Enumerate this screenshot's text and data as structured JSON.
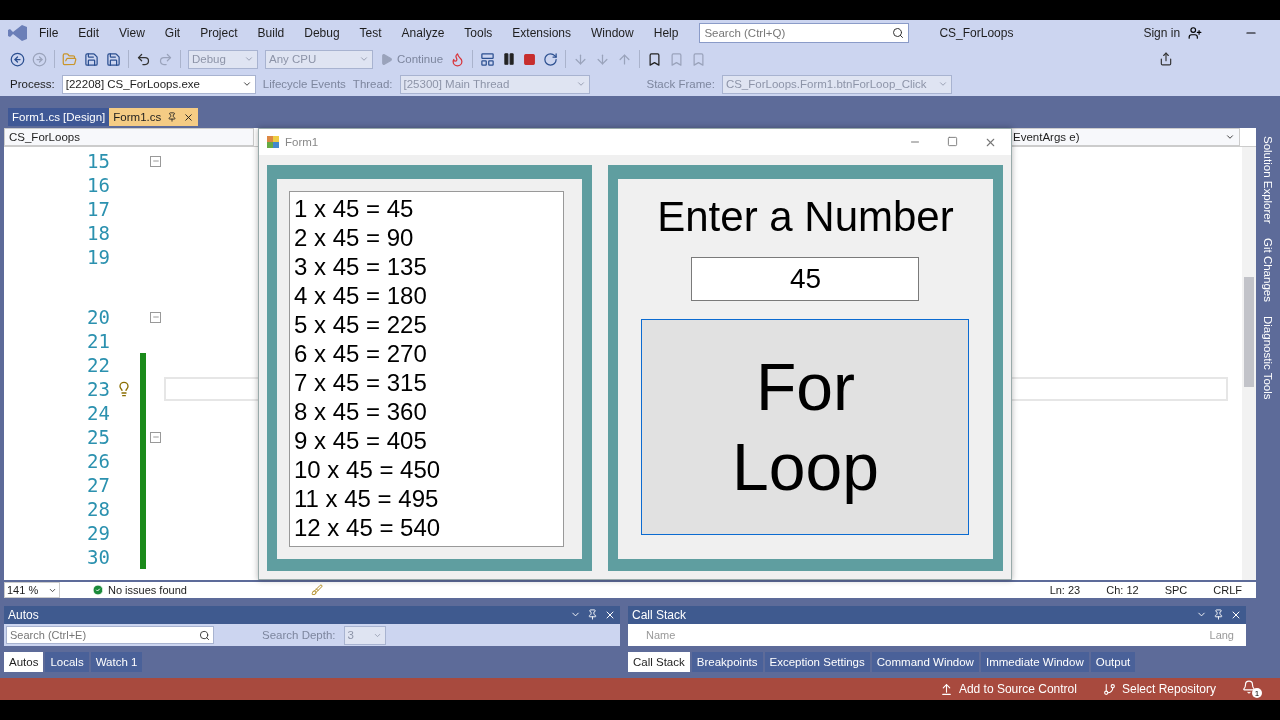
{
  "menu": [
    "File",
    "Edit",
    "View",
    "Git",
    "Project",
    "Build",
    "Debug",
    "Test",
    "Analyze",
    "Tools",
    "Extensions",
    "Window",
    "Help"
  ],
  "search": {
    "placeholder": "Search (Ctrl+Q)"
  },
  "solution_title": "CS_ForLoops",
  "sign_in": "Sign in",
  "toolbar": {
    "configuration": "Debug",
    "platform": "Any CPU",
    "continue": "Continue"
  },
  "debug_location": {
    "process_label": "Process:",
    "process": "[22208] CS_ForLoops.exe",
    "lifecycle": "Lifecycle Events",
    "thread_label": "Thread:",
    "thread": "[25300] Main Thread",
    "stack_frame_label": "Stack Frame:",
    "stack_frame": "CS_ForLoops.Form1.btnForLoop_Click"
  },
  "document_tabs": [
    {
      "label": "Form1.cs [Design]",
      "selected": false
    },
    {
      "label": "Form1.cs",
      "selected": true
    }
  ],
  "navigation": {
    "project": "CS_ForLoops",
    "member": "EventArgs e)"
  },
  "lines": [
    {
      "kind": "line",
      "number": "15",
      "fold": true,
      "changed": false,
      "current": false
    },
    {
      "kind": "line",
      "number": "16",
      "fold": false,
      "changed": false,
      "current": false
    },
    {
      "kind": "line",
      "number": "17",
      "fold": false,
      "changed": false,
      "current": false
    },
    {
      "kind": "line",
      "number": "18",
      "fold": false,
      "changed": false,
      "current": false
    },
    {
      "kind": "line",
      "number": "19",
      "fold": false,
      "changed": false,
      "current": false
    },
    {
      "kind": "codelens"
    },
    {
      "kind": "line",
      "number": "20",
      "fold": true,
      "changed": false,
      "current": false
    },
    {
      "kind": "line",
      "number": "21",
      "fold": false,
      "changed": false,
      "current": false
    },
    {
      "kind": "line",
      "number": "22",
      "fold": false,
      "changed": true,
      "current": false
    },
    {
      "kind": "line",
      "number": "23",
      "fold": false,
      "changed": true,
      "current": true
    },
    {
      "kind": "line",
      "number": "24",
      "fold": false,
      "changed": true,
      "current": false
    },
    {
      "kind": "line",
      "number": "25",
      "fold": true,
      "changed": true,
      "current": false
    },
    {
      "kind": "line",
      "number": "26",
      "fold": false,
      "changed": true,
      "current": false
    },
    {
      "kind": "line",
      "number": "27",
      "fold": false,
      "changed": true,
      "current": false
    },
    {
      "kind": "line",
      "number": "28",
      "fold": false,
      "changed": true,
      "current": false
    },
    {
      "kind": "line",
      "number": "29",
      "fold": false,
      "changed": true,
      "current": false
    },
    {
      "kind": "line",
      "number": "30",
      "fold": false,
      "changed": true,
      "current": false
    }
  ],
  "form": {
    "title": "Form1",
    "results": [
      "1 x 45 = 45",
      "2 x 45 = 90",
      "3 x 45 = 135",
      "4 x 45 = 180",
      "5 x 45 = 225",
      "6 x 45 = 270",
      "7 x 45 = 315",
      "8 x 45 = 360",
      "9 x 45 = 405",
      "10 x 45 = 450",
      "11 x 45 = 495",
      "12 x 45 = 540"
    ],
    "prompt": "Enter a Number",
    "input": "45",
    "button": "For Loop"
  },
  "editor_status": {
    "zoom": "141 %",
    "issues": "No issues found",
    "line": "Ln: 23",
    "column": "Ch: 12",
    "whitespace": "SPC",
    "line_ending": "CRLF"
  },
  "autos": {
    "title": "Autos",
    "search_placeholder": "Search (Ctrl+E)",
    "depth_label": "Search Depth:",
    "depth": "3",
    "tabs": [
      {
        "label": "Autos",
        "selected": true
      },
      {
        "label": "Locals",
        "selected": false
      },
      {
        "label": "Watch 1",
        "selected": false
      }
    ]
  },
  "call_stack": {
    "title": "Call Stack",
    "columns": [
      "Name",
      "Lang"
    ],
    "tabs": [
      {
        "label": "Call Stack",
        "selected": true
      },
      {
        "label": "Breakpoints",
        "selected": false
      },
      {
        "label": "Exception Settings",
        "selected": false
      },
      {
        "label": "Command Window",
        "selected": false
      },
      {
        "label": "Immediate Window",
        "selected": false
      },
      {
        "label": "Output",
        "selected": false
      }
    ]
  },
  "side_tabs": [
    "Solution Explorer",
    "Git Changes",
    "Diagnostic Tools"
  ],
  "status_bar": {
    "source_control": "Add to Source Control",
    "repository": "Select Repository",
    "notifications": "1"
  }
}
